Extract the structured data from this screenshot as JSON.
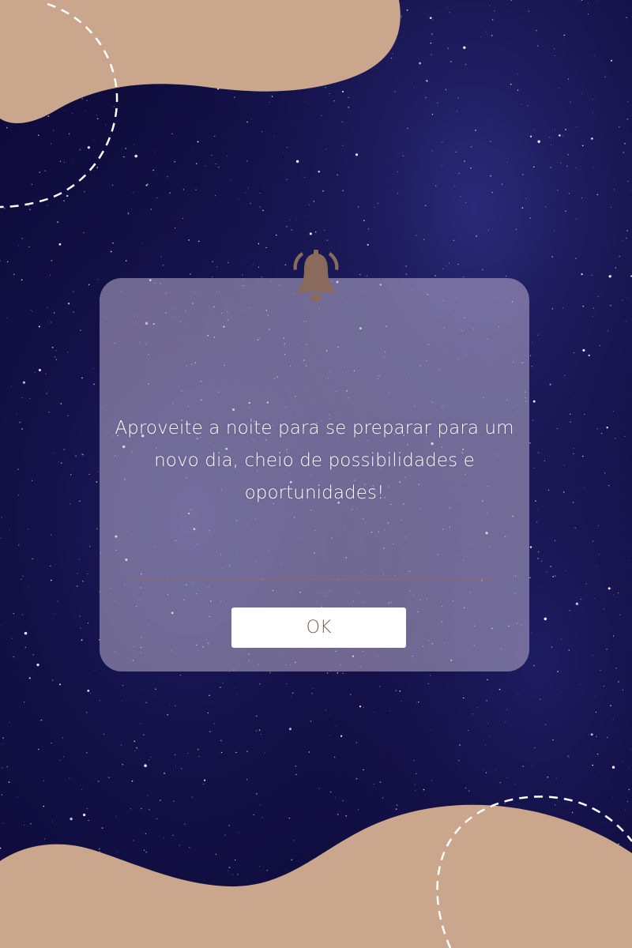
{
  "dialog": {
    "message": "Aproveite a noite para se preparar para um novo dia, cheio de possibilidades e oportunidades!",
    "ok_label": "OK"
  },
  "icons": {
    "bell": "bell-icon"
  },
  "colors": {
    "background": "#120f45",
    "accent_blob": "#c9a68c",
    "dialog_fill": "#c4b8d4",
    "bell": "#8a6a5a",
    "button_text": "#7a5c50",
    "divider": "#8a6e62",
    "text": "#ffffff"
  }
}
